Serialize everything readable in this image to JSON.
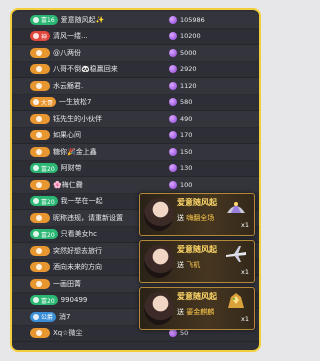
{
  "leaderboard": [
    {
      "rank": "",
      "badge": "富16",
      "badge_color": "#2bb673",
      "name": "爱意随风起✨",
      "score": "105986"
    },
    {
      "rank": "",
      "badge": "神",
      "badge_color": "#e0463c",
      "name": "清风一缕...",
      "score": "10200"
    },
    {
      "rank": "",
      "badge": "",
      "badge_color": "#e8962f",
      "name": "@八两份",
      "score": "5000"
    },
    {
      "rank": "",
      "badge": "",
      "badge_color": "#e8962f",
      "name": "八哥不倒🐼稳赢回来",
      "score": "2920"
    },
    {
      "rank": "",
      "badge": "",
      "badge_color": "#e8962f",
      "name": "水云觞君.",
      "score": "1120"
    },
    {
      "rank": "",
      "badge": "大哥",
      "badge_color": "#e8962f",
      "name": "一生放松7",
      "score": "580"
    },
    {
      "rank": "",
      "badge": "",
      "badge_color": "#e8962f",
      "name": "钰先生的小伙伴",
      "score": "490"
    },
    {
      "rank": "",
      "badge": "",
      "badge_color": "#e8962f",
      "name": "如果心间",
      "score": "170"
    },
    {
      "rank": "",
      "badge": "",
      "badge_color": "#e8962f",
      "name": "糖你🎉金上鑫",
      "score": "150"
    },
    {
      "rank": "",
      "badge": "富20",
      "badge_color": "#2bb673",
      "name": "阿财带",
      "score": "130"
    },
    {
      "rank": "",
      "badge": "",
      "badge_color": "#e8962f",
      "name": "🌸梅仁爨",
      "score": "100"
    },
    {
      "rank": "",
      "badge": "富20",
      "badge_color": "#2bb673",
      "name": "我一举在一起",
      "score": ""
    },
    {
      "rank": "",
      "badge": "",
      "badge_color": "#e8962f",
      "name": "昵称违规，请重新设置",
      "score": ""
    },
    {
      "rank": "",
      "badge": "富20",
      "badge_color": "#2bb673",
      "name": "只看美女hc",
      "score": ""
    },
    {
      "rank": "",
      "badge": "",
      "badge_color": "#e8962f",
      "name": "突然好想去旅行",
      "score": ""
    },
    {
      "rank": "",
      "badge": "",
      "badge_color": "#e8962f",
      "name": "酒向未来的方向",
      "score": ""
    },
    {
      "rank": "",
      "badge": "",
      "badge_color": "#e8962f",
      "name": "一画田菁",
      "score": ""
    },
    {
      "rank": "",
      "badge": "富20",
      "badge_color": "#2bb673",
      "name": "990499",
      "score": ""
    },
    {
      "rank": "",
      "badge": "公爵",
      "badge_color": "#3a8fd6",
      "name": "消7",
      "score": ""
    },
    {
      "rank": "",
      "badge": "",
      "badge_color": "#e8962f",
      "name": "Xq☆微尘",
      "score": "50"
    }
  ],
  "popups": [
    {
      "sender": "爱意随风起",
      "verb": "送",
      "gift": "嗨翻全场",
      "qty": "x1"
    },
    {
      "sender": "爱意随风起",
      "verb": "送",
      "gift": "飞机",
      "qty": "x1"
    },
    {
      "sender": "爱意随风起",
      "verb": "送",
      "gift": "鎏金麒麟",
      "qty": "x1"
    }
  ]
}
